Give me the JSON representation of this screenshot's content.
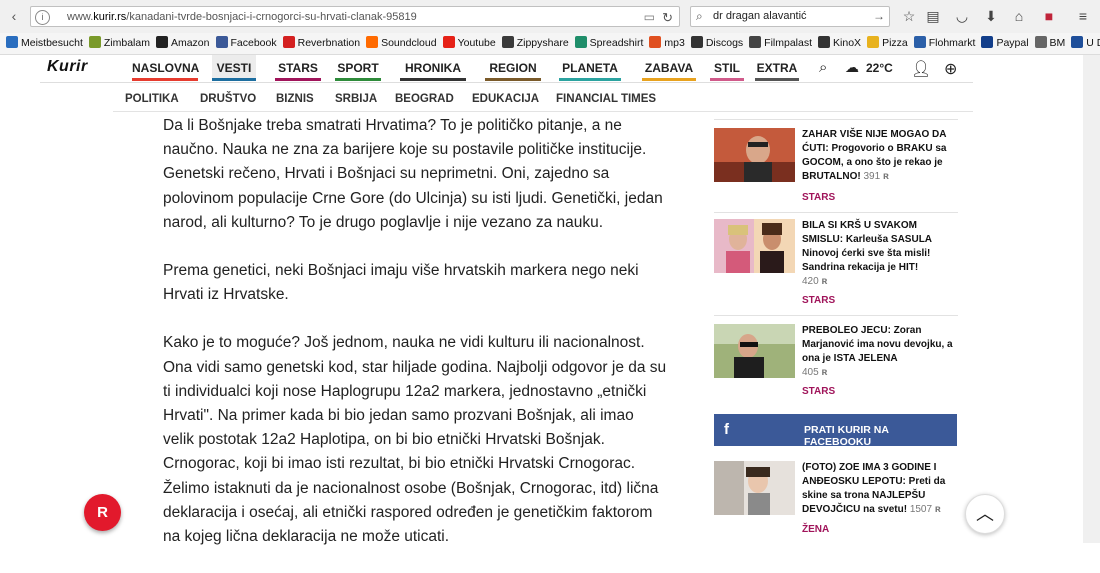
{
  "browser": {
    "url_prefix": "www.",
    "url_domain": "kurir.rs",
    "url_path": "/kanadani-tvrde-bosnjaci-i-crnogorci-su-hrvati-clanak-95819",
    "search_value": "dr dragan alavantić",
    "bookmarks": [
      {
        "label": "Meistbesucht",
        "color": "#2a6ebf"
      },
      {
        "label": "Zimbalam",
        "color": "#7a9a2a"
      },
      {
        "label": "Amazon",
        "color": "#222222"
      },
      {
        "label": "Facebook",
        "color": "#3b5998"
      },
      {
        "label": "Reverbnation",
        "color": "#d42020"
      },
      {
        "label": "Soundcloud",
        "color": "#ff6a00"
      },
      {
        "label": "Youtube",
        "color": "#e62117"
      },
      {
        "label": "Zippyshare",
        "color": "#3a3a3a"
      },
      {
        "label": "Spreadshirt",
        "color": "#1f8e6a"
      },
      {
        "label": "mp3",
        "color": "#e05020"
      },
      {
        "label": "Discogs",
        "color": "#333333"
      },
      {
        "label": "Filmpalast",
        "color": "#444444"
      },
      {
        "label": "KinoX",
        "color": "#333333"
      },
      {
        "label": "Pizza",
        "color": "#e8b21e"
      },
      {
        "label": "Flohmarkt",
        "color": "#2b5fa8"
      },
      {
        "label": "Paypal",
        "color": "#123e8a"
      },
      {
        "label": "BM",
        "color": "#666666"
      },
      {
        "label": "U D",
        "color": "#1f4f9a"
      }
    ]
  },
  "site": {
    "logo": "Kurir",
    "nav": [
      {
        "label": "NASLOVNA",
        "underline": "#e63b2e"
      },
      {
        "label": "VESTI",
        "underline": "#1d6ea0",
        "active": true
      },
      {
        "label": "STARS",
        "underline": "#a0145a"
      },
      {
        "label": "SPORT",
        "underline": "#2e8b3a"
      },
      {
        "label": "HRONIKA",
        "underline": "#333333"
      },
      {
        "label": "REGION",
        "underline": "#7a5a2a"
      },
      {
        "label": "PLANETA",
        "underline": "#2ba3a0"
      },
      {
        "label": "ZABAVA",
        "underline": "#e8a21e"
      },
      {
        "label": "STIL",
        "underline": "#d05a8a"
      },
      {
        "label": "EXTRA",
        "underline": "#555555"
      }
    ],
    "temperature": "22°C",
    "subnav": [
      "POLITIKA",
      "DRUŠTVO",
      "BIZNIS",
      "SRBIJA",
      "BEOGRAD",
      "EDUKACIJA",
      "FINANCIAL TIMES"
    ]
  },
  "article": {
    "paragraphs": [
      "Da li Bošnjake treba smatrati Hrvatima? To je političko pitanje, a ne naučno. Nauka ne zna za barijere koje su postavile političke institucije. Genetski rečeno, Hrvati i Bošnjaci su neprimetni. Oni, zajedno sa polovinom populacije Crne Gore (do Ulcinja) su isti ljudi. Genetički, jedan narod, ali kulturno? To je drugo poglavlje i nije vezano za nauku.",
      "Prema genetici, neki Bošnjaci imaju više hrvatskih markera nego neki Hrvati iz Hrvatske.",
      "Kako je to moguće? Još jednom, nauka ne vidi kulturu ili nacionalnost. Ona vidi samo genetski kod, star hiljade godina. Najbolji odgovor je da su ti individualci koji nose Haplogrupu 12a2 markera, jednostavno „etnički Hrvati\". Na primer kada bi bio jedan samo prozvani Bošnjak, ali imao velik postotak 12a2 Haplotipa, on bi bio etnički Hrvatski Bošnjak. Crnogorac, koji bi imao isti rezultat, bi bio etnički Hrvatski Crnogorac. Želimo istaknuti da je nacionalnost osobe (Bošnjak, Crnogorac, itd) lična  deklaracija i osećaj, ali etnički raspored određen je genetičkim faktorom na kojeg lična deklaracija ne može uticati."
    ]
  },
  "sidebar": {
    "items": [
      {
        "title": "ZAHAR VIŠE NIJE MOGAO DA ĆUTI: Progovorio o BRAKU sa GOCOM, a ono što je rekao je BRUTALNO!",
        "count": "391",
        "category": "STARS"
      },
      {
        "title": "BILA SI KRŠ U SVAKOM SMISLU: Karleuša SASULA Ninovoj ćerki sve šta misli! Sandrina rekacija je HIT!",
        "count": "420",
        "category": "STARS"
      },
      {
        "title": "PREBOLEO JECU: Zoran Marjanović ima novu devojku, a ona je ISTA JELENA",
        "count": "405",
        "category": "STARS"
      },
      {
        "title": "(FOTO) ZOE IMA 3 GODINE I ANĐEOSKU LEPOTU: Preti da skine sa trona NAJLEPŠU DEVOJČICU na svetu!",
        "count": "1507",
        "category": "ŽENA"
      }
    ],
    "facebook_label": "PRATI KURIR NA FACEBOOKU",
    "facebook_icon": "f"
  },
  "fab_label": "R",
  "colors": {
    "accent": "#e2192c",
    "category": "#a0145a",
    "facebook": "#3b5998"
  }
}
